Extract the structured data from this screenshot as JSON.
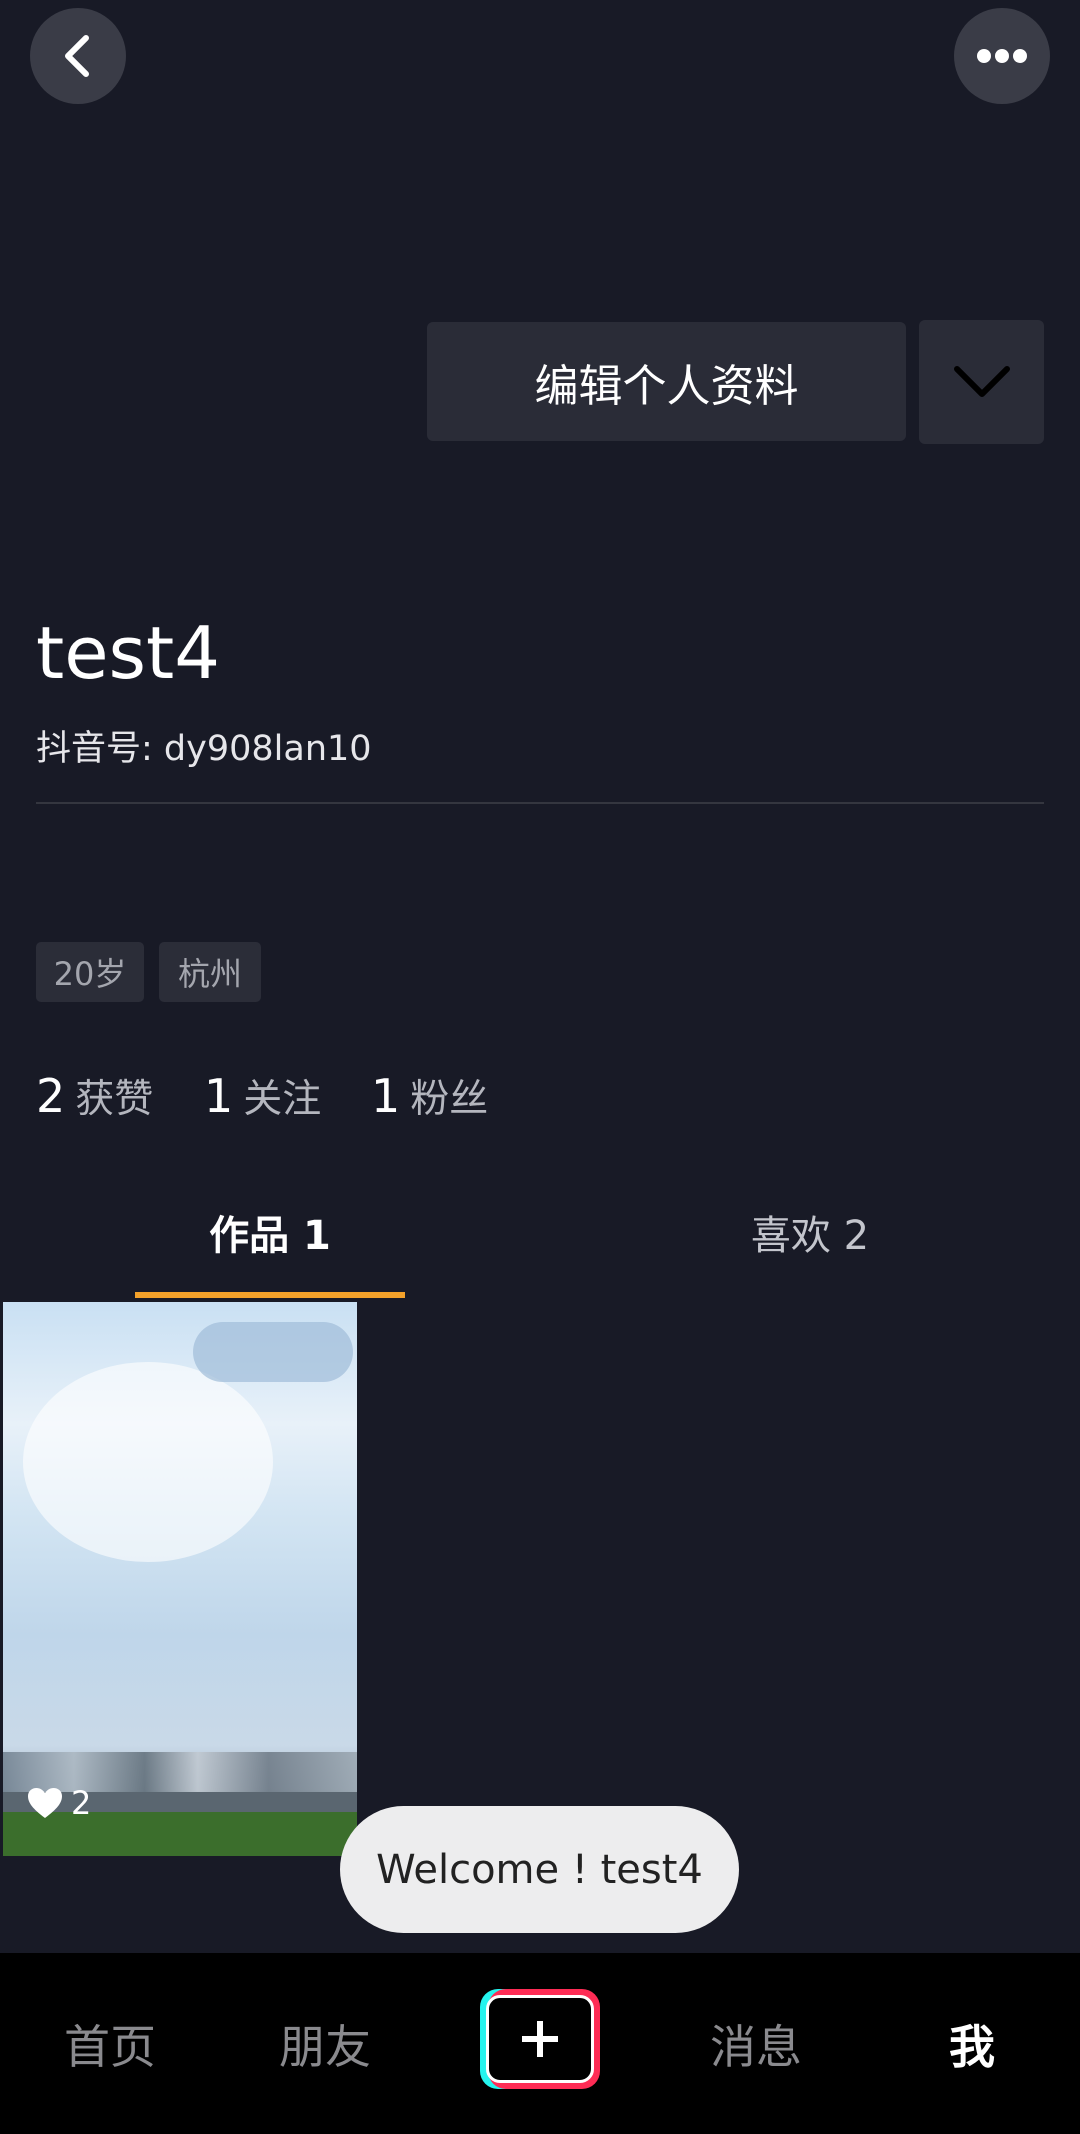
{
  "top_bar": {
    "back_icon": "chevron-left-icon",
    "more_icon": "more-dots-icon"
  },
  "profile": {
    "edit_button_label": "编辑个人资料",
    "dropdown_icon": "chevron-down-icon",
    "username": "test4",
    "douyin_id": "抖音号: dy908lan10",
    "tags": [
      "20岁",
      "杭州"
    ],
    "stats": [
      {
        "num": "2",
        "label": "获赞"
      },
      {
        "num": "1",
        "label": "关注"
      },
      {
        "num": "1",
        "label": "粉丝"
      }
    ]
  },
  "tabs": [
    {
      "label": "作品 1",
      "active": true
    },
    {
      "label": "喜欢 2",
      "active": false
    }
  ],
  "videos": [
    {
      "likes": "2",
      "like_icon": "heart-icon"
    }
  ],
  "toast": {
    "text": "Welcome ! test4"
  },
  "bottom_nav": {
    "home": "首页",
    "friends": "朋友",
    "add_icon": "plus-icon",
    "messages": "消息",
    "me": "我"
  },
  "colors": {
    "background": "#181a26",
    "tab_indicator": "#f3a12a",
    "button_bg": "#2a2c37"
  }
}
